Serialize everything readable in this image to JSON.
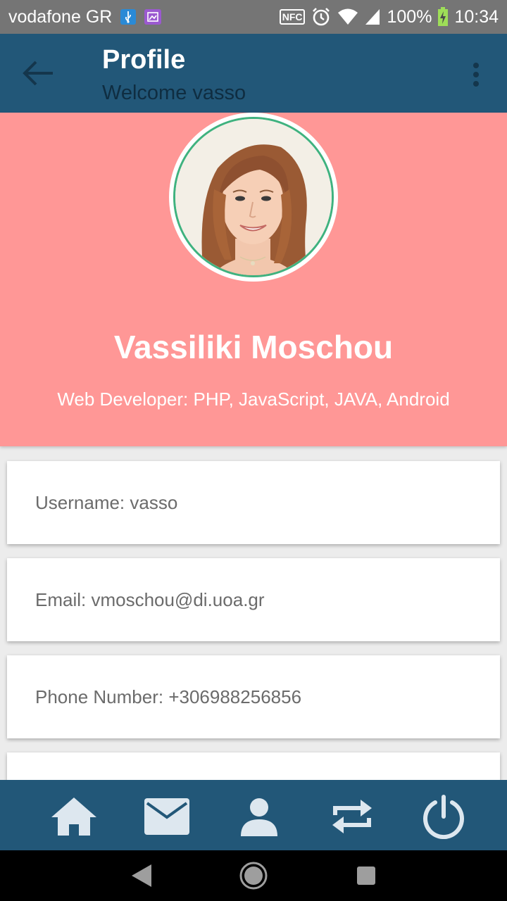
{
  "status_bar": {
    "carrier": "vodafone GR",
    "nfc_label": "NFC",
    "battery": "100%",
    "time": "10:34"
  },
  "app_bar": {
    "title": "Profile",
    "subtitle": "Welcome vasso"
  },
  "profile": {
    "name": "Vassiliki Moschou",
    "role": "Web Developer: PHP, JavaScript, JAVA, Android"
  },
  "details": {
    "username": "Username: vasso",
    "email": "Email: vmoschou@di.uoa.gr",
    "phone": "Phone Number: +306988256856",
    "fourth": ""
  },
  "bottom_nav": {
    "items": [
      "home-icon",
      "mail-icon",
      "person-icon",
      "repeat-icon",
      "power-icon"
    ]
  },
  "colors": {
    "app_bar": "#225778",
    "header": "#ff9796",
    "avatar_border": "#3fb27f",
    "nav_icon": "#dde7ef"
  }
}
